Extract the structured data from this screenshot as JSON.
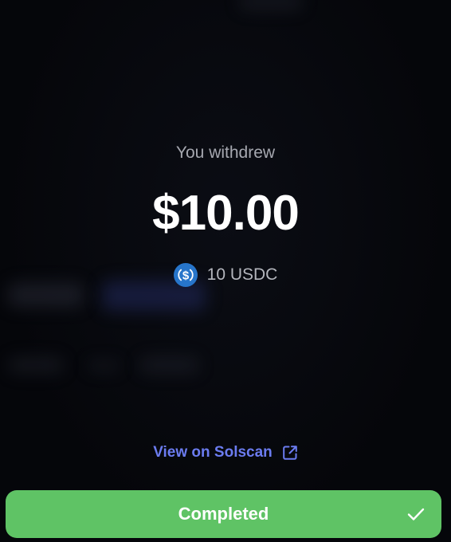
{
  "withdraw": {
    "label": "You withdrew",
    "amount": "$10.00",
    "token_amount": "10 USDC",
    "token_icon": "usdc-icon"
  },
  "link": {
    "label": "View on Solscan",
    "icon": "external-link-icon"
  },
  "status_button": {
    "label": "Completed",
    "icon": "checkmark-icon"
  },
  "colors": {
    "background": "#06070b",
    "link": "#6b7cf0",
    "button": "#5fc365",
    "usdc": "#2775ca"
  }
}
